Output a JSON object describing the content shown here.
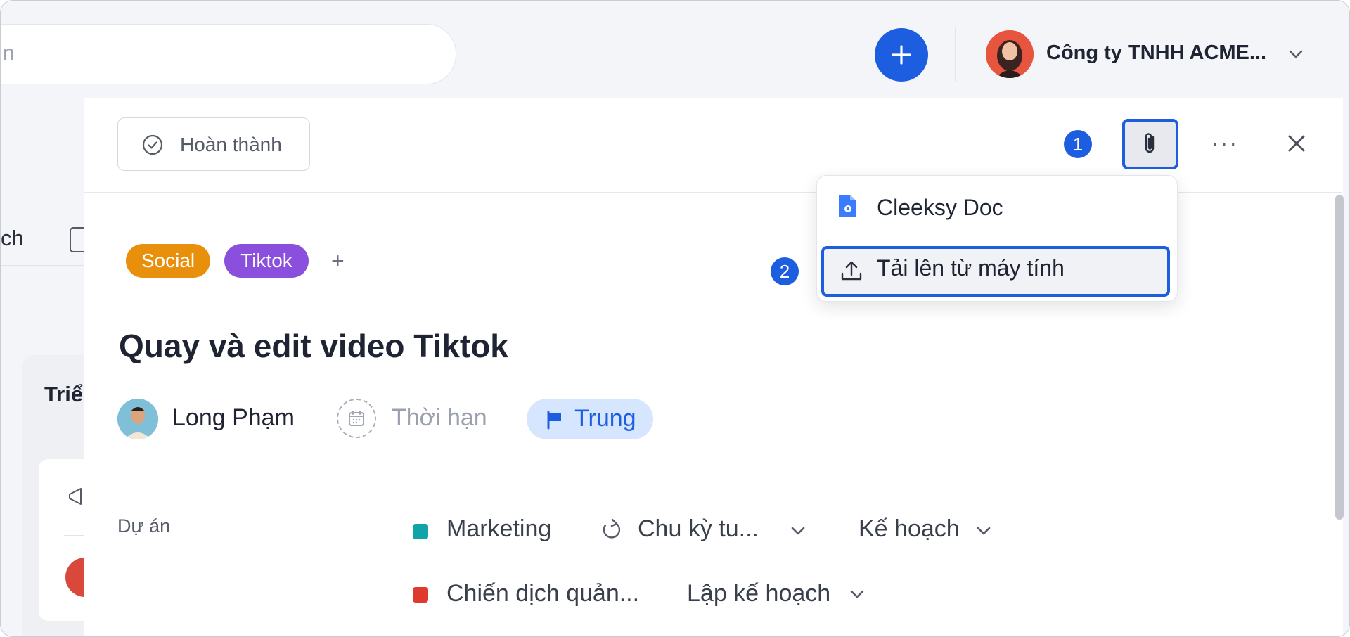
{
  "header": {
    "search_placeholder": "n",
    "company_name": "Công ty TNHH ACME..."
  },
  "background": {
    "tab_label": "ch",
    "card_title": "Triể"
  },
  "panel": {
    "complete_label": "Hoàn thành",
    "more_label": "···",
    "badges": {
      "step1": "1",
      "step2": "2"
    },
    "attach_menu": {
      "items": [
        {
          "label": "Cleeksy Doc",
          "icon": "doc-icon"
        },
        {
          "label": "Tải lên từ máy tính",
          "icon": "upload-icon"
        }
      ]
    },
    "tags": [
      {
        "label": "Social",
        "color": "#e8900b"
      },
      {
        "label": "Tiktok",
        "color": "#8a4fdc"
      }
    ],
    "tag_add": "+",
    "title": "Quay và edit video Tiktok",
    "assignee": "Long Phạm",
    "due_placeholder": "Thời hạn",
    "priority": {
      "label": "Trung",
      "color": "#1d5ee0"
    },
    "project_label": "Dự án",
    "projects": [
      {
        "name": "Marketing",
        "color": "#10a3a8",
        "cycle": "Chu kỳ tu...",
        "stage": "Kế hoạch"
      },
      {
        "name": "Chiến dịch quản...",
        "color": "#e03a2f",
        "stage": "Lập kế hoạch"
      }
    ]
  },
  "colors": {
    "accent": "#1d5ee0"
  }
}
